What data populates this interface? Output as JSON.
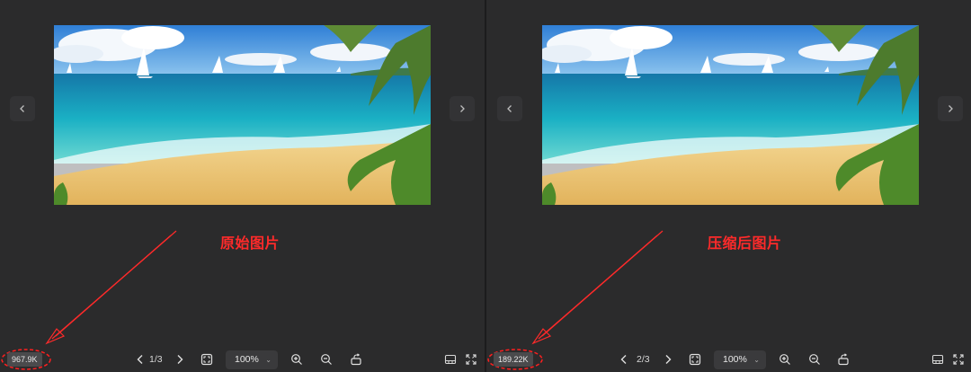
{
  "colors": {
    "annotation": "#ff2a2a",
    "background": "#2b2b2c"
  },
  "panels": [
    {
      "caption": "原始图片",
      "file_size": "967.9K",
      "page_indicator": "1/3",
      "zoom": "100%"
    },
    {
      "caption": "压缩后图片",
      "file_size": "189.22K",
      "page_indicator": "2/3",
      "zoom": "100%"
    }
  ],
  "icons": {
    "prev": "chevron-left-icon",
    "next": "chevron-right-icon",
    "fit": "fit-screen-icon",
    "zoom_in": "zoom-in-icon",
    "zoom_out": "zoom-out-icon",
    "rotate": "rotate-icon",
    "thumbnails": "thumbnail-strip-icon",
    "fullscreen": "fullscreen-icon"
  }
}
